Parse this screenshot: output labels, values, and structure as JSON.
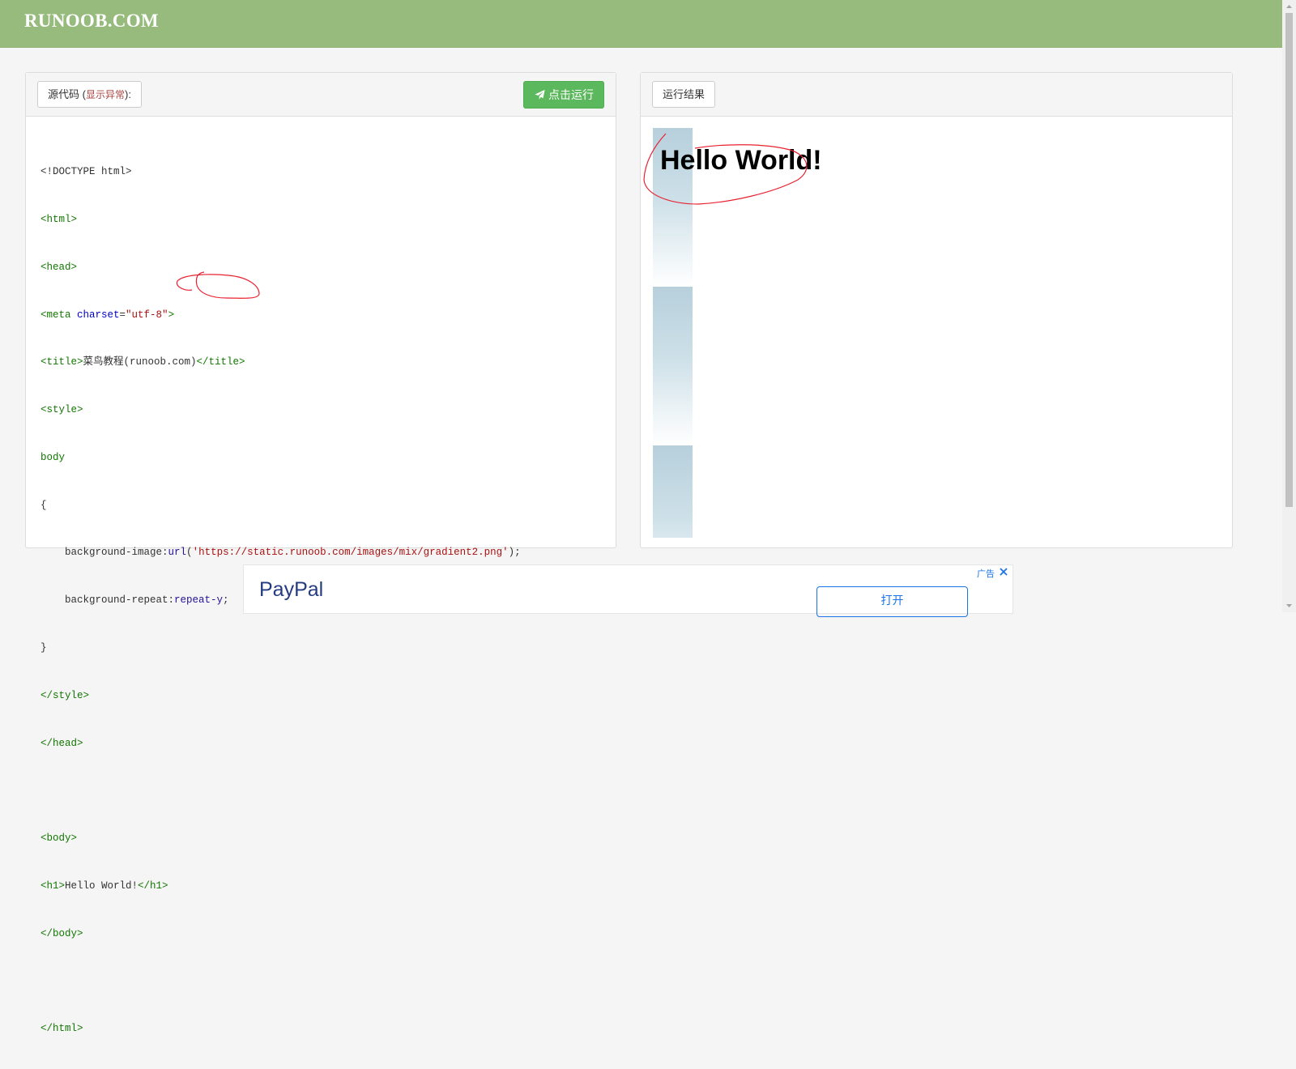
{
  "site": {
    "logo": "RUNOOB.COM"
  },
  "source_panel": {
    "title": "源代码",
    "warn_open": " (",
    "warn_label": "显示异常",
    "warn_close": "):",
    "run_button": "点击运行"
  },
  "result_panel": {
    "title": "运行结果",
    "heading": "Hello World!"
  },
  "code": {
    "l1": "<!DOCTYPE html>",
    "l2": "<html>",
    "l3": "<head>",
    "l4a": "<meta ",
    "l4b": "charset",
    "l4c": "=",
    "l4d": "\"utf-8\"",
    "l4e": ">",
    "l5a": "<title>",
    "l5b": "菜鸟教程(runoob.com)",
    "l5c": "</title>",
    "l6": "<style>",
    "l7": "body",
    "l8": "{",
    "l9a": "    background-image:",
    "l9b": "url",
    "l9c": "(",
    "l9d": "'https://static.runoob.com/images/mix/gradient2.png'",
    "l9e": ");",
    "l10a": "    background-repeat:",
    "l10b": "repeat-y",
    "l10c": ";",
    "l11": "}",
    "l12": "</style>",
    "l13": "</head>",
    "l14": "",
    "l15": "<body>",
    "l16a": "<h1>",
    "l16b": "Hello World!",
    "l16c": "</h1>",
    "l17": "</body>",
    "l18": "",
    "l19": "</html>"
  },
  "ad": {
    "brand": "PayPal",
    "label": "广告",
    "open_button": "打开"
  },
  "colors": {
    "topbar": "#96bb7c",
    "run_button": "#5cb85c",
    "code_tag": "#117700",
    "code_attr": "#0000cc",
    "code_string": "#aa1111",
    "code_keyword": "#221199"
  }
}
